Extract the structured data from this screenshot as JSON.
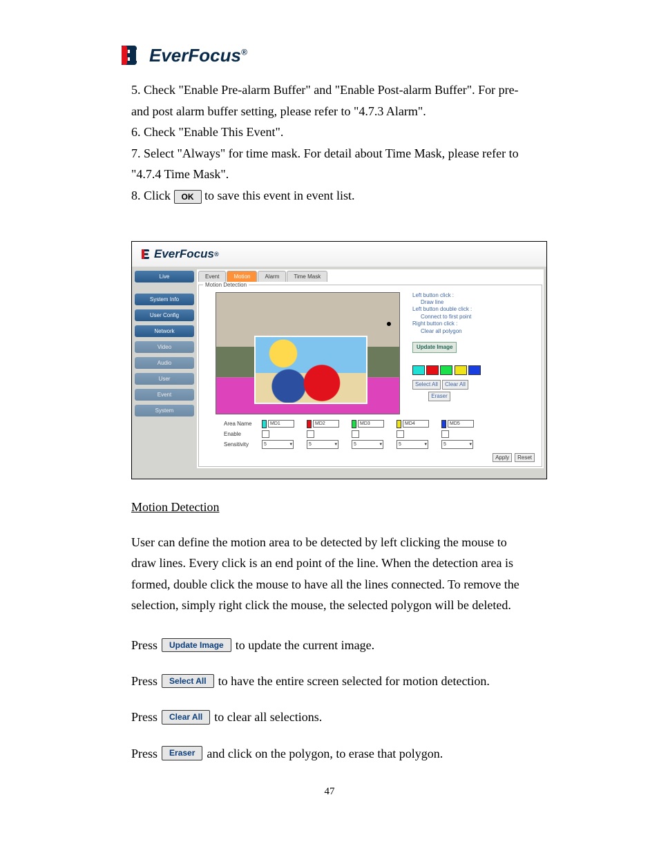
{
  "brand": {
    "name": "EverFocus",
    "reg": "®"
  },
  "steps": {
    "s5": "5. Check \"Enable Pre-alarm Buffer\" and \"Enable Post-alarm Buffer\". For pre-and post alarm buffer setting, please refer to \"4.7.3 Alarm\".",
    "s6": "6. Check \"Enable This Event\".",
    "s7": "7. Select \"Always\" for time mask. For detail about Time Mask, please refer to \"4.7.4 Time Mask\".",
    "s8a": "8. Click ",
    "s8b": " to save this event in event list."
  },
  "ok_button": "OK",
  "screenshot": {
    "sidebar": [
      "Live",
      "System Info",
      "User Config",
      "Network",
      "Video",
      "Audio",
      "User",
      "Event",
      "System"
    ],
    "tabs": [
      "Event",
      "Motion",
      "Alarm",
      "Time Mask"
    ],
    "active_tab": 1,
    "fieldset_title": "Motion Detection",
    "help": {
      "l1": "Left button click :",
      "l1s": "Draw line",
      "l2": "Left button double click :",
      "l2s": "Connect to first point",
      "l3": "Right button click :",
      "l3s": "Clear all polygon"
    },
    "update_btn": "Update Image",
    "select_all": "Select All",
    "clear_all": "Clear All",
    "eraser": "Eraser",
    "swatch_colors": [
      "#1fe0d2",
      "#e60f15",
      "#1ce04a",
      "#efe31a",
      "#1a3fe0"
    ],
    "row_labels": {
      "area": "Area Name",
      "enable": "Enable",
      "sens": "Sensitivity"
    },
    "columns": [
      {
        "color": "#1fe0d2",
        "name": "MD1",
        "sens": "5"
      },
      {
        "color": "#e60f15",
        "name": "MD2",
        "sens": "5"
      },
      {
        "color": "#1ce04a",
        "name": "MD3",
        "sens": "5"
      },
      {
        "color": "#efe31a",
        "name": "MD4",
        "sens": "5"
      },
      {
        "color": "#1a3fe0",
        "name": "MD5",
        "sens": "5"
      }
    ],
    "apply": "Apply",
    "reset": "Reset"
  },
  "section_heading": "Motion Detection",
  "motion_intro": "User can define the motion area to be detected by left clicking the mouse to draw lines. Every click is an end point of the line. When the detection area is formed, double click the mouse to have all the lines connected. To remove the selection, simply right click the mouse, the selected polygon will be deleted.",
  "press": {
    "word": "Press ",
    "p1_btn": "Update Image",
    "p1_tail": " to update the current image.",
    "p2_btn": "Select All",
    "p2_tail": " to have the entire screen selected for motion detection.",
    "p3_btn": "Clear All",
    "p3_tail": " to clear all selections.",
    "p4_btn": "Eraser",
    "p4_tail": " and click on the polygon, to erase that polygon."
  },
  "page_number": "47"
}
